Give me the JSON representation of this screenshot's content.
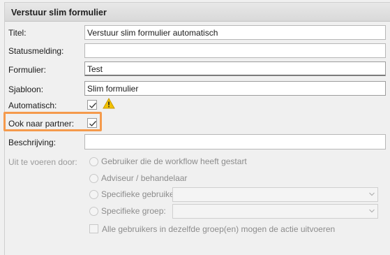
{
  "header": {
    "title": "Verstuur slim formulier"
  },
  "fields": {
    "titel": {
      "label": "Titel:",
      "value": "Verstuur slim formulier automatisch"
    },
    "statusmelding": {
      "label": "Statusmelding:",
      "value": ""
    },
    "formulier": {
      "label": "Formulier:",
      "value": "Test"
    },
    "sjabloon": {
      "label": "Sjabloon:",
      "value": "Slim formulier"
    },
    "automatisch": {
      "label": "Automatisch:",
      "checked": true,
      "icon": "warning-icon"
    },
    "ook_naar_partner": {
      "label": "Ook naar partner:",
      "checked": true
    },
    "beschrijving": {
      "label": "Beschrijving:",
      "value": ""
    }
  },
  "uitvoeren": {
    "label": "Uit te voeren door:",
    "options": [
      {
        "label": "Gebruiker die de workflow heeft gestart"
      },
      {
        "label": "Adviseur / behandelaar"
      },
      {
        "label": "Specifieke gebruiker:",
        "select_value": ""
      },
      {
        "label": "Specifieke groep:",
        "select_value": ""
      }
    ],
    "alle_gebruikers": {
      "label": "Alle gebruikers in dezelfde groep(en) mogen de actie uitvoeren",
      "checked": false
    }
  },
  "colors": {
    "highlight": "#f59a4c",
    "warning": "#f2c200"
  }
}
